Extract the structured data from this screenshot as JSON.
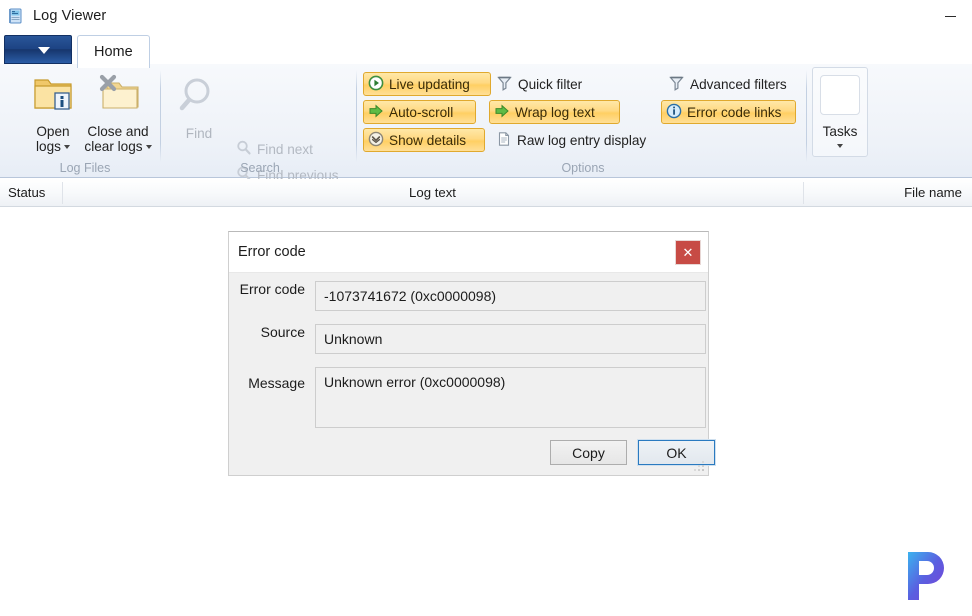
{
  "window": {
    "title": "Log Viewer",
    "icon": "log-viewer-icon",
    "minimize_label": "–"
  },
  "ribbon": {
    "app_menu_icon": "chevron-down-icon",
    "tabs": [
      {
        "label": "Home",
        "active": true
      }
    ],
    "groups": [
      {
        "name": "Log Files",
        "label": "Log Files",
        "buttons": [
          {
            "label_line1": "Open",
            "label_line2": "logs",
            "icon": "open-logs-folder-icon",
            "has_dropdown": true,
            "disabled": false
          },
          {
            "label_line1": "Close and",
            "label_line2": "clear logs",
            "icon": "close-clear-logs-icon",
            "has_dropdown": true,
            "disabled": false
          }
        ]
      },
      {
        "name": "Search",
        "label": "Search",
        "big_button": {
          "label": "Find",
          "icon": "magnifier-icon",
          "disabled": true
        },
        "items": [
          {
            "label": "Find next",
            "icon": "magnifier-small-icon",
            "disabled": true,
            "toggled": false
          },
          {
            "label": "Find previous",
            "icon": "magnifier-small-icon",
            "disabled": true,
            "toggled": false
          }
        ]
      },
      {
        "name": "Options",
        "label": "Options",
        "column1": [
          {
            "label": "Live updating",
            "icon": "play-circle-icon",
            "toggled": true
          },
          {
            "label": "Auto-scroll",
            "icon": "green-arrow-icon",
            "toggled": true
          },
          {
            "label": "Show details",
            "icon": "chevron-circle-down-icon",
            "toggled": true
          }
        ],
        "column2": [
          {
            "label": "Quick filter",
            "icon": "funnel-icon",
            "toggled": false
          },
          {
            "label": "Wrap log text",
            "icon": "green-arrow-icon",
            "toggled": true
          },
          {
            "label": "Raw log entry display",
            "icon": "document-icon",
            "toggled": false
          }
        ],
        "column3": [
          {
            "label": "Advanced filters",
            "icon": "funnel-icon",
            "toggled": false
          },
          {
            "label": "Error code links",
            "icon": "info-circle-icon",
            "toggled": true
          }
        ]
      },
      {
        "name": "Tasks",
        "label": "",
        "button": {
          "label": "Tasks",
          "icon": "tasks-icon",
          "has_dropdown": true
        }
      }
    ]
  },
  "log_table": {
    "columns": [
      {
        "key": "status",
        "label": "Status"
      },
      {
        "key": "log_text",
        "label": "Log text"
      },
      {
        "key": "file_name",
        "label": "File name"
      }
    ],
    "rows": []
  },
  "dialog": {
    "title": "Error code",
    "close_label": "✕",
    "fields": [
      {
        "label": "Error code",
        "value": "-1073741672 (0xc0000098)",
        "multiline": false
      },
      {
        "label": "Source",
        "value": "Unknown",
        "multiline": false
      },
      {
        "label": "Message",
        "value": "Unknown error (0xc0000098)",
        "multiline": true
      }
    ],
    "buttons": [
      {
        "label": "Copy",
        "primary": false
      },
      {
        "label": "OK",
        "primary": true
      }
    ]
  },
  "watermark": {
    "logo_letter": "P",
    "colors": {
      "start": "#3bb3ef",
      "mid": "#5a5fe0",
      "end": "#7b3fd6"
    }
  },
  "colors": {
    "toggle_gold": "#ffd982",
    "toggle_border": "#e0a92e",
    "close_red": "#c74b45",
    "accent_blue": "#2a7ac0",
    "ribbon_bg": "#eef2f8"
  }
}
